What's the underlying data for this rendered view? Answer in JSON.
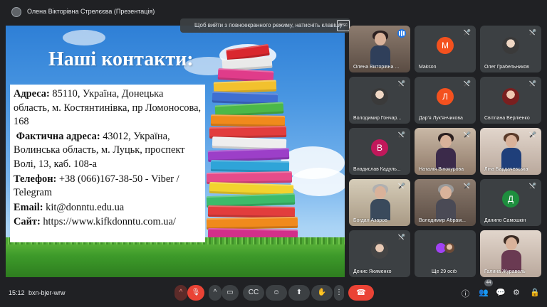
{
  "header": {
    "presenter_title": "Олена Вікторівна Стрелєєва (Презентація)"
  },
  "fullscreen_notice": {
    "text": "Щоб вийти з повноекранного режиму, натисніть клавішу",
    "key": "Esc"
  },
  "slide": {
    "heading": "Наші контакти:",
    "address_label": "Адреса:",
    "address_value": " 85110, Україна, Донецька область, м. Костянтинівка, пр Ломоносова, 168",
    "actual_label": "Фактична адреса:",
    "actual_value": " 43012, Україна, Волинська область, м. Луцьк, проспект Волі, 13, каб. 108-а",
    "phone_label": "Телефон:",
    "phone_value": " +38 (066)167-38-50 - Viber / Telegram",
    "email_label": "Email:",
    "email_value": " kit@donntu.edu.ua",
    "site_label": "Сайт:",
    "site_value": " https://www.kifkdonntu.com.ua/"
  },
  "participants": [
    {
      "name": "Олена Вікторівна ...",
      "kind": "video"
    },
    {
      "name": "Makson",
      "kind": "avatar",
      "initial": "M",
      "color": "#f4511e"
    },
    {
      "name": "Олег Грабельников",
      "kind": "photo"
    },
    {
      "name": "Володимир Гончар...",
      "kind": "photo"
    },
    {
      "name": "Дар'я Лук'янчикова",
      "kind": "avatar",
      "initial": "Л",
      "color": "#f4511e"
    },
    {
      "name": "Світлана Верліенко",
      "kind": "photo"
    },
    {
      "name": "Владислав Кадуль...",
      "kind": "avatar",
      "initial": "В",
      "color": "#c2185b"
    },
    {
      "name": "Наталія Вінокурова",
      "kind": "video"
    },
    {
      "name": "Ліна Бардачевська",
      "kind": "video"
    },
    {
      "name": "Богдан Азаров",
      "kind": "video"
    },
    {
      "name": "Володимир Абрам...",
      "kind": "video"
    },
    {
      "name": "Данило Самошкін",
      "kind": "avatar",
      "initial": "Д",
      "color": "#1e8e3e"
    },
    {
      "name": "Денис Якименко",
      "kind": "photo"
    },
    {
      "name": "Ще 29 осіб",
      "kind": "more"
    },
    {
      "name": "Галина Журавель",
      "kind": "video"
    }
  ],
  "bottom": {
    "time": "15:12",
    "meeting_code": "bxn-bjer-wrw",
    "participant_count": "44"
  }
}
